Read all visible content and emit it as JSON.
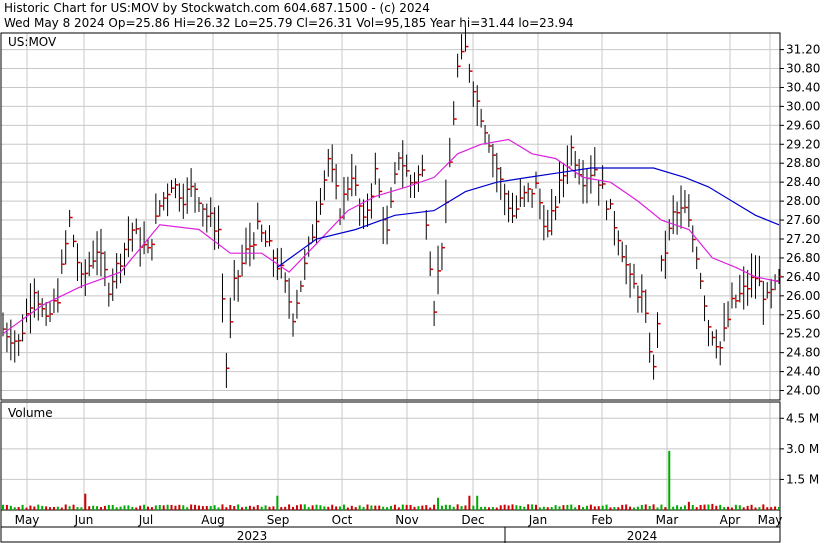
{
  "header": {
    "line1": "Historic Chart for US:MOV by Stockwatch.com 604.687.1500 - (c) 2024",
    "line2": "Wed May  8 2024  Op=25.86  Hi=26.32  Lo=25.79  Cl=26.31  Vol=95,185  Year hi=31.44  lo=23.94"
  },
  "colors": {
    "price_bar": "#000000",
    "close_tick": "#cc0000",
    "ma_short": "#dd22dd",
    "ma_long": "#0000cc",
    "volume_up": "#00aa00",
    "volume_down": "#cc0000",
    "grid": "#c8c8c8",
    "border": "#000000"
  },
  "chart_data": [
    {
      "type": "bar",
      "subtype": "ohlc",
      "legend": "US:MOV",
      "y_ticks": [
        "31.20",
        "30.80",
        "30.40",
        "30.00",
        "29.60",
        "29.20",
        "28.80",
        "28.40",
        "28.00",
        "27.60",
        "27.20",
        "26.80",
        "26.40",
        "26.00",
        "25.60",
        "25.20",
        "24.80",
        "24.40",
        "24.00"
      ],
      "ylim": [
        23.8,
        31.55
      ],
      "month_labels": [
        "May",
        "Jun",
        "Jul",
        "Aug",
        "Sep",
        "Oct",
        "Nov",
        "Dec",
        "Jan",
        "Feb",
        "Mar",
        "Apr",
        "May"
      ],
      "year_labels": [
        "2023",
        "2024"
      ],
      "anchors": [
        [
          0,
          25.3
        ],
        [
          4,
          25.0
        ],
        [
          8,
          26.2
        ],
        [
          11,
          25.4
        ],
        [
          14,
          26.0
        ],
        [
          17,
          27.6
        ],
        [
          20,
          26.3
        ],
        [
          24,
          27.0
        ],
        [
          27,
          26.2
        ],
        [
          30,
          26.8
        ],
        [
          33,
          27.4
        ],
        [
          37,
          26.9
        ],
        [
          40,
          27.9
        ],
        [
          43,
          28.4
        ],
        [
          46,
          28.1
        ],
        [
          49,
          28.3
        ],
        [
          52,
          27.7
        ],
        [
          55,
          27.4
        ],
        [
          57,
          24.5
        ],
        [
          59,
          26.2
        ],
        [
          62,
          26.9
        ],
        [
          65,
          27.4
        ],
        [
          68,
          27.0
        ],
        [
          71,
          26.5
        ],
        [
          74,
          25.6
        ],
        [
          77,
          26.6
        ],
        [
          80,
          27.7
        ],
        [
          83,
          28.9
        ],
        [
          86,
          27.8
        ],
        [
          89,
          28.6
        ],
        [
          92,
          27.5
        ],
        [
          95,
          28.6
        ],
        [
          98,
          27.3
        ],
        [
          101,
          29.0
        ],
        [
          104,
          28.4
        ],
        [
          107,
          28.6
        ],
        [
          110,
          25.8
        ],
        [
          113,
          27.8
        ],
        [
          116,
          30.8
        ],
        [
          118,
          31.2
        ],
        [
          121,
          30.1
        ],
        [
          124,
          29.3
        ],
        [
          127,
          28.4
        ],
        [
          130,
          27.7
        ],
        [
          133,
          28.1
        ],
        [
          136,
          28.3
        ],
        [
          139,
          27.3
        ],
        [
          142,
          28.3
        ],
        [
          145,
          29.1
        ],
        [
          148,
          28.5
        ],
        [
          151,
          28.7
        ],
        [
          154,
          28.0
        ],
        [
          157,
          27.3
        ],
        [
          160,
          26.3
        ],
        [
          163,
          26.0
        ],
        [
          166,
          24.4
        ],
        [
          168,
          26.6
        ],
        [
          171,
          27.7
        ],
        [
          174,
          27.8
        ],
        [
          177,
          26.9
        ],
        [
          180,
          25.4
        ],
        [
          183,
          24.9
        ],
        [
          186,
          25.8
        ],
        [
          189,
          26.1
        ],
        [
          192,
          26.4
        ],
        [
          195,
          25.9
        ],
        [
          198,
          26.3
        ]
      ],
      "n_bars": 199,
      "series": [
        {
          "name": "",
          "color": "#dd22dd",
          "values": [
            [
              0,
              25.2
            ],
            [
              10,
              25.8
            ],
            [
              20,
              26.2
            ],
            [
              30,
              26.5
            ],
            [
              40,
              27.5
            ],
            [
              50,
              27.4
            ],
            [
              58,
              26.9
            ],
            [
              66,
              26.9
            ],
            [
              73,
              26.5
            ],
            [
              80,
              27.1
            ],
            [
              88,
              27.8
            ],
            [
              95,
              28.1
            ],
            [
              103,
              28.3
            ],
            [
              110,
              28.5
            ],
            [
              116,
              29.0
            ],
            [
              122,
              29.2
            ],
            [
              129,
              29.3
            ],
            [
              135,
              29.0
            ],
            [
              141,
              28.9
            ],
            [
              148,
              28.5
            ],
            [
              155,
              28.4
            ],
            [
              162,
              28.0
            ],
            [
              168,
              27.6
            ],
            [
              175,
              27.4
            ],
            [
              181,
              26.8
            ],
            [
              187,
              26.6
            ],
            [
              192,
              26.4
            ],
            [
              198,
              26.3
            ]
          ]
        },
        {
          "name": "",
          "color": "#0000cc",
          "values": [
            [
              70,
              26.6
            ],
            [
              80,
              27.2
            ],
            [
              90,
              27.4
            ],
            [
              100,
              27.7
            ],
            [
              110,
              27.8
            ],
            [
              118,
              28.2
            ],
            [
              126,
              28.4
            ],
            [
              134,
              28.5
            ],
            [
              142,
              28.6
            ],
            [
              150,
              28.7
            ],
            [
              158,
              28.7
            ],
            [
              166,
              28.7
            ],
            [
              174,
              28.5
            ],
            [
              180,
              28.3
            ],
            [
              186,
              28.0
            ],
            [
              192,
              27.7
            ],
            [
              198,
              27.5
            ]
          ]
        }
      ]
    },
    {
      "type": "bar",
      "subtype": "volume",
      "legend": "Volume",
      "y_ticks": [
        "4.5 M",
        "3.0 M",
        "1.5 M"
      ],
      "ylim": [
        0,
        5.3
      ],
      "spikes": [
        [
          21,
          0.8
        ],
        [
          70,
          0.7
        ],
        [
          111,
          0.6
        ],
        [
          119,
          0.7
        ],
        [
          121,
          0.7
        ],
        [
          170,
          2.9
        ],
        [
          175,
          0.4
        ],
        [
          181,
          0.3
        ],
        [
          190,
          0.2
        ]
      ],
      "baseline": 0.2
    }
  ]
}
